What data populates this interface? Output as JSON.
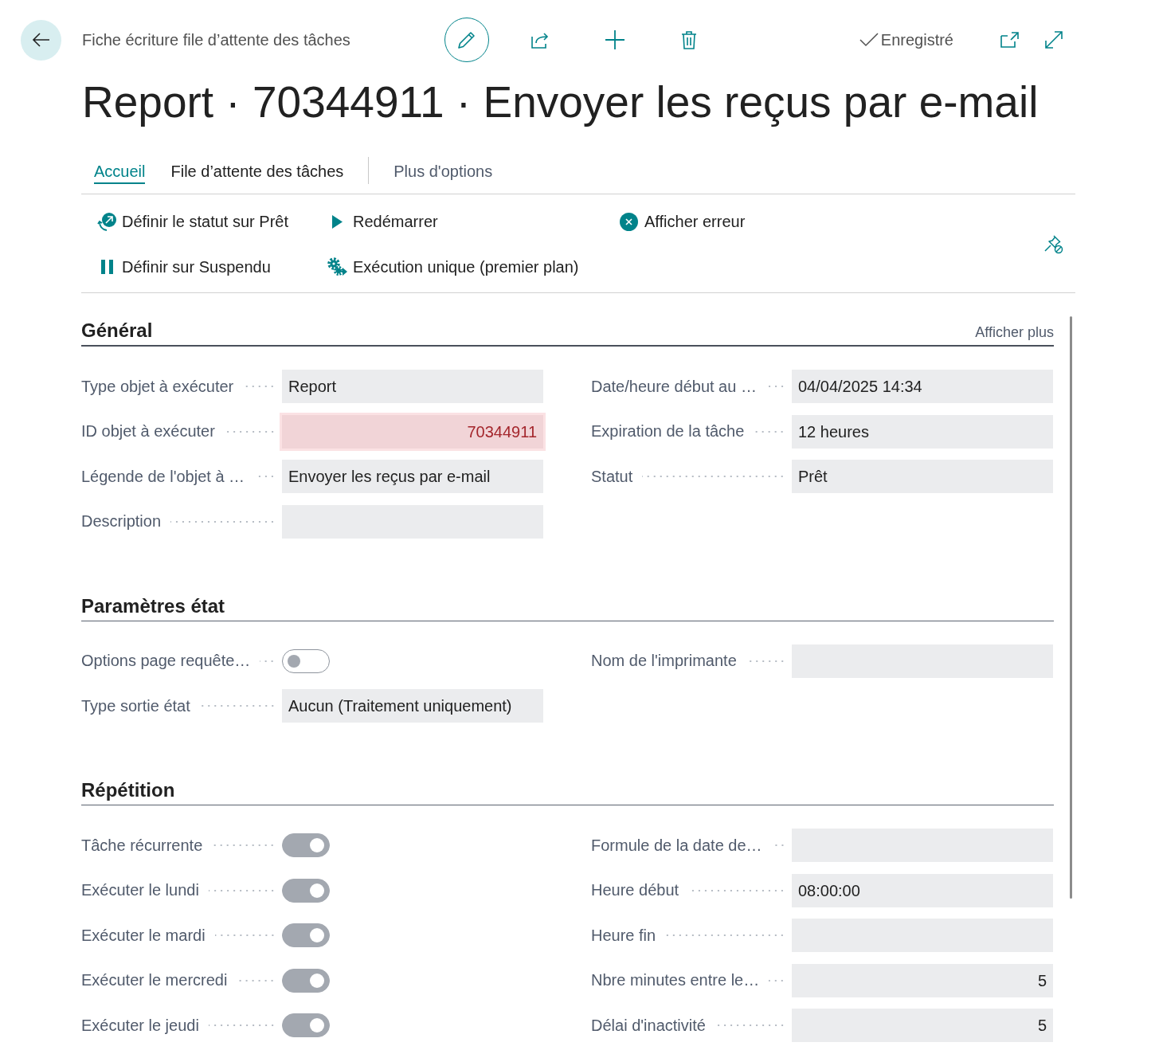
{
  "header": {
    "breadcrumb": "Fiche écriture file d’attente des tâches",
    "edit_mode": true,
    "save_status": "Enregistré"
  },
  "title": "Report · 70344911 · Envoyer les reçus par e-mail",
  "tabs": [
    {
      "label": "Accueil",
      "kind": "tab",
      "selected": true
    },
    {
      "label": "File d’attente des tâches",
      "kind": "tab",
      "selected": false
    },
    {
      "label": "Plus d'options",
      "kind": "menu",
      "selected": false
    }
  ],
  "actions": [
    {
      "label": "Définir le statut sur Prêt"
    },
    {
      "label": "Redémarrer"
    },
    {
      "label": "Afficher erreur"
    },
    {
      "label": "Définir sur Suspendu"
    },
    {
      "label": "Exécution unique (premier plan)"
    }
  ],
  "sections": [
    {
      "title": "Général",
      "selected": true,
      "show_more": "Afficher plus",
      "left": [
        {
          "label": "Type objet à exécuter",
          "kind": "text",
          "value": "Report",
          "error": false
        },
        {
          "label": "ID objet à exécuter",
          "kind": "number",
          "value": "70344911",
          "error": true
        },
        {
          "label": "Légende de l'objet à …",
          "kind": "text",
          "value": "Envoyer les reçus par e-mail",
          "error": false
        },
        {
          "label": "Description",
          "kind": "text",
          "error": false
        }
      ],
      "right": [
        {
          "label": "Date/heure début au …",
          "kind": "text",
          "value": "04/04/2025 14:34",
          "error": false
        },
        {
          "label": "Expiration de la tâche",
          "kind": "text",
          "value": "12 heures",
          "error": false
        },
        {
          "label": "Statut",
          "kind": "text",
          "value": "Prêt",
          "error": false
        }
      ]
    },
    {
      "title": "Paramètres état",
      "selected": false,
      "left": [
        {
          "label": "Options page requête…",
          "kind": "toggle",
          "checked": false
        },
        {
          "label": "Type sortie état",
          "kind": "text",
          "value": "Aucun (Traitement uniquement)",
          "error": false
        }
      ],
      "right": [
        {
          "label": "Nom de l'imprimante",
          "kind": "text",
          "error": false
        }
      ]
    },
    {
      "title": "Répétition",
      "selected": false,
      "left": [
        {
          "label": "Tâche récurrente",
          "kind": "toggle",
          "checked": true
        },
        {
          "label": "Exécuter le lundi",
          "kind": "toggle",
          "checked": true
        },
        {
          "label": "Exécuter le mardi",
          "kind": "toggle",
          "checked": true
        },
        {
          "label": "Exécuter le mercredi",
          "kind": "toggle",
          "checked": true
        },
        {
          "label": "Exécuter le jeudi",
          "kind": "toggle",
          "checked": true
        }
      ],
      "right": [
        {
          "label": "Formule de la date de…",
          "kind": "text",
          "error": false
        },
        {
          "label": "Heure début",
          "kind": "text",
          "value": "08:00:00",
          "error": false
        },
        {
          "label": "Heure fin",
          "kind": "text",
          "error": false
        },
        {
          "label": "Nbre minutes entre le…",
          "kind": "number",
          "value": "5",
          "error": false
        },
        {
          "label": "Délai d'inactivité",
          "kind": "number",
          "value": "5",
          "error": false
        }
      ]
    }
  ]
}
